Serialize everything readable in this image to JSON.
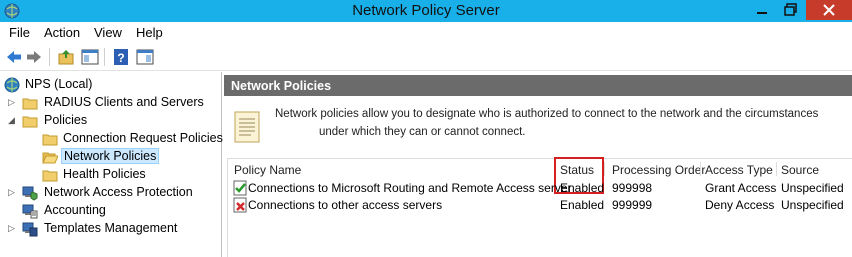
{
  "window": {
    "title": "Network Policy Server",
    "controls": {
      "minimize": "minimize",
      "maximize": "restore",
      "close": "close"
    }
  },
  "menu": [
    "File",
    "Action",
    "View",
    "Help"
  ],
  "toolbar": [
    "back-arrow-icon",
    "forward-arrow-icon",
    "up-folder-icon",
    "show-hide-console-tree-icon",
    "help-icon",
    "properties-pane-icon"
  ],
  "tree": {
    "root": "NPS (Local)",
    "items": [
      {
        "label": "RADIUS Clients and Servers",
        "expander": "collapsed",
        "icon": "folder-icon"
      },
      {
        "label": "Policies",
        "expander": "expanded",
        "icon": "folder-icon"
      },
      {
        "label": "Connection Request Policies",
        "icon": "folder-icon"
      },
      {
        "label": "Network Policies",
        "icon": "folder-open-icon",
        "selected": true
      },
      {
        "label": "Health Policies",
        "icon": "folder-icon"
      },
      {
        "label": "Network Access Protection",
        "expander": "collapsed",
        "icon": "nap-icon"
      },
      {
        "label": "Accounting",
        "icon": "accounting-icon"
      },
      {
        "label": "Templates Management",
        "expander": "collapsed",
        "icon": "templates-icon"
      }
    ]
  },
  "main": {
    "header": "Network Policies",
    "description_line1": "Network policies allow you to designate who is authorized to connect to the network and the circumstances",
    "description_line2": "under which they can or cannot connect.",
    "columns": [
      "Policy Name",
      "Status",
      "Processing Order",
      "Access Type",
      "Source"
    ],
    "rows": [
      {
        "name": "Connections to Microsoft Routing and Remote Access server",
        "status": "Enabled",
        "order": "999998",
        "access": "Grant Access",
        "source": "Unspecified",
        "icon": "policy-grant-icon"
      },
      {
        "name": "Connections to other access servers",
        "status": "Enabled",
        "order": "999999",
        "access": "Deny Access",
        "source": "Unspecified",
        "icon": "policy-deny-icon"
      }
    ],
    "highlight_color": "#d42020"
  },
  "colors": {
    "titlebar": "#19b0ea",
    "close": "#c73b2b",
    "header": "#6b6b6b",
    "selection": "#cce8ff"
  }
}
